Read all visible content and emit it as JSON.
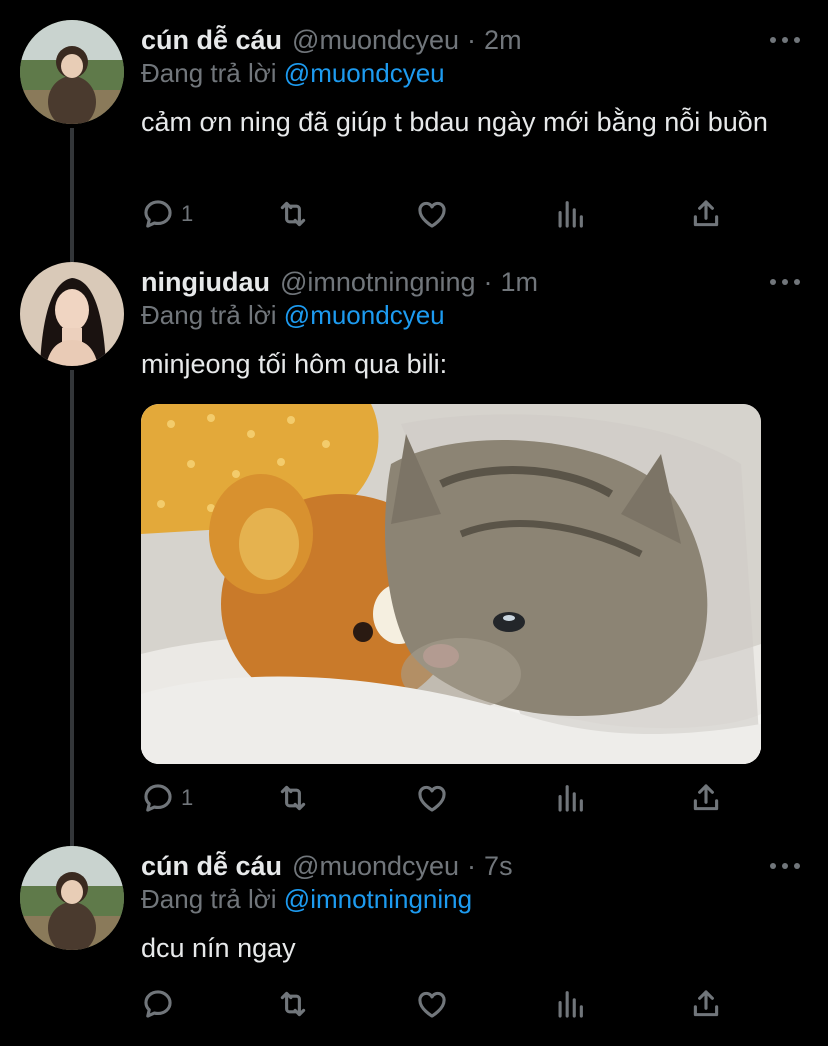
{
  "tweets": [
    {
      "name": "cún dễ cáu",
      "handle": "@muondcyeu",
      "dot": "·",
      "time": "2m",
      "replying_prefix": "Đang trả lời",
      "replying_to": "@muondcyeu",
      "text": "cảm ơn ning đã giúp t bdau ngày mới bằng nỗi buồn",
      "reply_count": "1"
    },
    {
      "name": "ningiudau",
      "handle": "@imnotningning",
      "dot": "·",
      "time": "1m",
      "replying_prefix": "Đang trả lời",
      "replying_to": "@muondcyeu",
      "text": "minjeong tối hôm qua bili:",
      "reply_count": "1"
    },
    {
      "name": "cún dễ cáu",
      "handle": "@muondcyeu",
      "dot": "·",
      "time": "7s",
      "replying_prefix": "Đang trả lời",
      "replying_to": "@imnotningning",
      "text": "dcu nín ngay",
      "reply_count": ""
    }
  ],
  "icons": {
    "reply": "reply-icon",
    "retweet": "retweet-icon",
    "like": "heart-icon",
    "analytics": "analytics-icon",
    "share": "share-icon",
    "more": "more-icon"
  },
  "colors": {
    "background": "#000000",
    "link": "#1d9bf0",
    "muted": "#71767b",
    "text": "#e7e9ea"
  }
}
